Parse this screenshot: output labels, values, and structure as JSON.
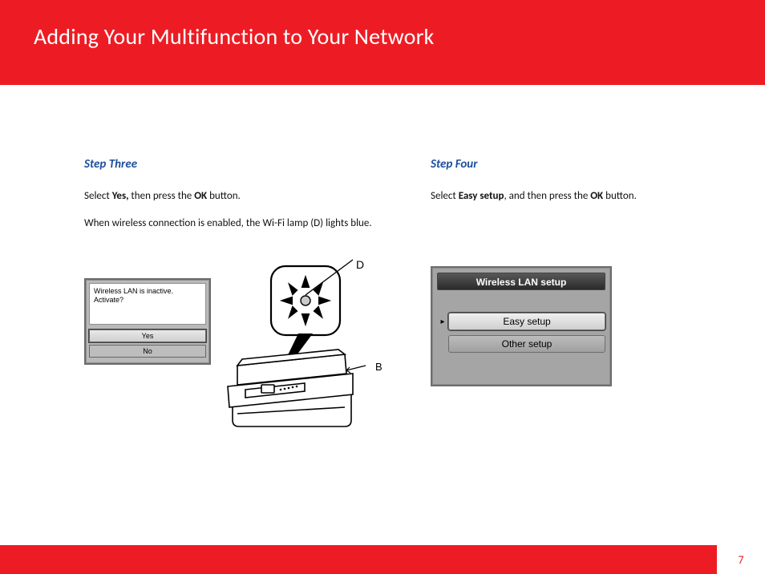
{
  "header": {
    "title": "Adding Your Multifunction to Your Network"
  },
  "step3": {
    "title": "Step Three",
    "line1_pre": "Select ",
    "line1_b1": "Yes,",
    "line1_mid": " then press the ",
    "line1_b2": "OK",
    "line1_post": " button.",
    "line2": "When wireless connection is enabled, the Wi-Fi lamp (D) lights blue.",
    "screen": {
      "msg1": "Wireless LAN is inactive.",
      "msg2": "Activate?",
      "yes": "Yes",
      "no": "No"
    },
    "label_d": "D",
    "label_b": "B"
  },
  "step4": {
    "title": "Step Four",
    "line1_pre": "Select ",
    "line1_b1": "Easy setup",
    "line1_mid": ", and then press the ",
    "line1_b2": "OK",
    "line1_post": " button.",
    "screen": {
      "title": "Wireless LAN setup",
      "easy": "Easy setup",
      "other": "Other setup"
    }
  },
  "footer": {
    "page": "7"
  }
}
